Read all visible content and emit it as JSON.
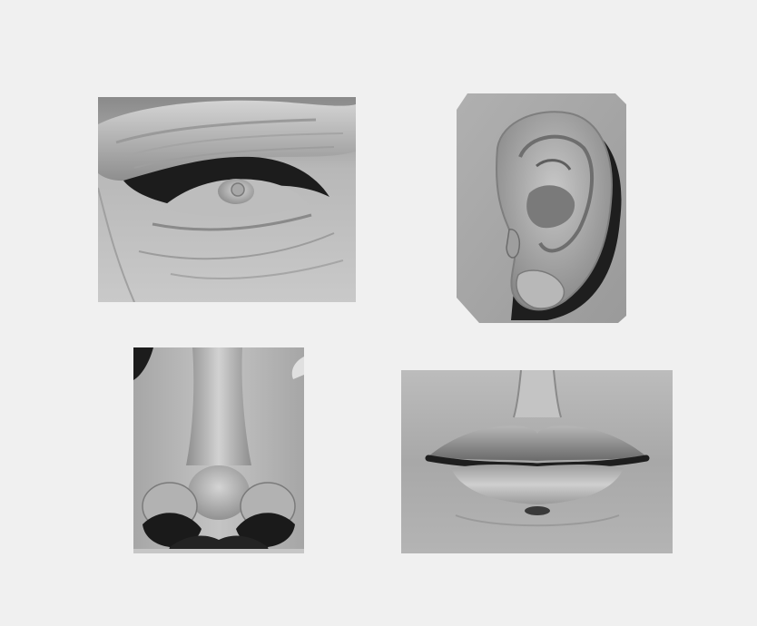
{
  "scene": {
    "background_color": "#f0f0f0",
    "material_light": "#cfcfcf",
    "material_mid": "#9a9a9a",
    "material_dark": "#1a1a1a"
  },
  "panels": [
    {
      "subject": "eye",
      "icon": "sculpted-eye-study"
    },
    {
      "subject": "ear",
      "icon": "sculpted-ear-study"
    },
    {
      "subject": "nose",
      "icon": "sculpted-nose-study"
    },
    {
      "subject": "mouth",
      "icon": "sculpted-mouth-study"
    }
  ]
}
